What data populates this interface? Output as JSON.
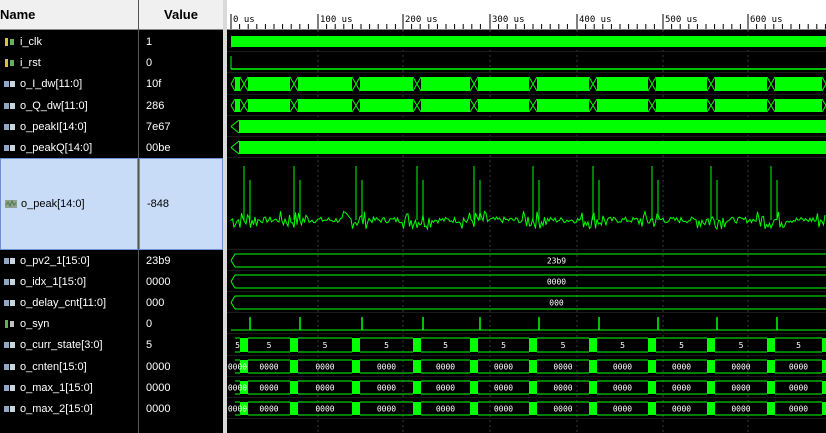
{
  "header": {
    "name_col": "Name",
    "value_col": "Value"
  },
  "timeline": {
    "ticks": [
      "0 us",
      "100 us",
      "200 us",
      "300 us",
      "400 us",
      "500 us",
      "600 us"
    ]
  },
  "signals": [
    {
      "name": "i_clk",
      "value": "1",
      "icon": "bit-input-icon",
      "kind": "clock"
    },
    {
      "name": "i_rst",
      "value": "0",
      "icon": "bit-input-icon",
      "kind": "low"
    },
    {
      "name": "o_I_dw[11:0]",
      "value": "10f",
      "icon": "bus-output-icon",
      "kind": "dense-bus"
    },
    {
      "name": "o_Q_dw[11:0]",
      "value": "286",
      "icon": "bus-output-icon",
      "kind": "dense-bus"
    },
    {
      "name": "o_peakI[14:0]",
      "value": "7e67",
      "icon": "bus-output-icon",
      "kind": "solid-bus"
    },
    {
      "name": "o_peakQ[14:0]",
      "value": "00be",
      "icon": "bus-output-icon",
      "kind": "solid-bus"
    },
    {
      "name": "o_peak[14:0]",
      "value": "-848",
      "icon": "analog-icon",
      "kind": "analog"
    },
    {
      "name": "o_pv2_1[15:0]",
      "value": "23b9",
      "icon": "bus-output-icon",
      "kind": "const-bus",
      "label": "23b9"
    },
    {
      "name": "o_idx_1[15:0]",
      "value": "0000",
      "icon": "bus-output-icon",
      "kind": "const-bus",
      "label": "0000"
    },
    {
      "name": "o_delay_cnt[11:0]",
      "value": "000",
      "icon": "bus-output-icon",
      "kind": "const-bus",
      "label": "000"
    },
    {
      "name": "o_syn",
      "value": "0",
      "icon": "bit-output-icon",
      "kind": "pulse"
    },
    {
      "name": "o_curr_state[3:0]",
      "value": "5",
      "icon": "bus-output-icon",
      "kind": "state-bus",
      "label": "5"
    },
    {
      "name": "o_cnten[15:0]",
      "value": "0000",
      "icon": "bus-output-icon",
      "kind": "state-bus",
      "label": "0000"
    },
    {
      "name": "o_max_1[15:0]",
      "value": "0000",
      "icon": "bus-output-icon",
      "kind": "state-bus",
      "label": "0000"
    },
    {
      "name": "o_max_2[15:0]",
      "value": "0000",
      "icon": "bus-output-icon",
      "kind": "state-bus",
      "label": "0000"
    }
  ],
  "colors": {
    "wave": "#00ff00",
    "selection": "#c8dcf8",
    "header_bg": "#f0f0f0"
  }
}
